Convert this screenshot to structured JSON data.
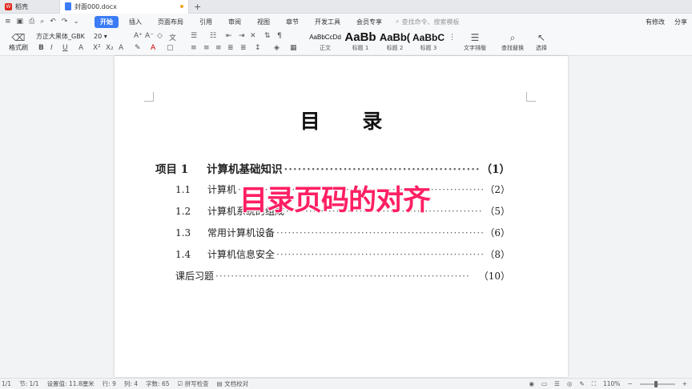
{
  "tabs": [
    {
      "label": "稻壳"
    },
    {
      "label": "封面000.docx"
    }
  ],
  "menu": {
    "tabs": [
      "开始",
      "插入",
      "页面布局",
      "引用",
      "审阅",
      "视图",
      "章节",
      "开发工具",
      "会员专享"
    ],
    "active": "开始",
    "search_placeholder": "查找命令、搜索模板",
    "right": [
      "有修改",
      "分享"
    ]
  },
  "ribbon": {
    "format_brush": "格式刷",
    "font_name": "方正大黑体_GBK",
    "font_size": "20",
    "styles": [
      {
        "preview": "AaBbCcDd",
        "label": "正文"
      },
      {
        "preview": "AaBb",
        "label": "标题 1"
      },
      {
        "preview": "AaBb(",
        "label": "标题 2"
      },
      {
        "preview": "AaBbC",
        "label": "标题 3"
      }
    ],
    "tools": [
      "文字排版",
      "查找替换",
      "选择"
    ]
  },
  "document": {
    "title": "目 录",
    "toc": [
      {
        "num": "项目 1",
        "text": "计算机基础知识",
        "page": "（1）",
        "level": 1
      },
      {
        "num": "1.1",
        "text": "计算机",
        "page": "（2）",
        "level": 2
      },
      {
        "num": "1.2",
        "text": "计算机系统的组成",
        "page": "（5）",
        "level": 2
      },
      {
        "num": "1.3",
        "text": "常用计算机设备",
        "page": "（6）",
        "level": 2
      },
      {
        "num": "1.4",
        "text": "计算机信息安全",
        "page": "（8）",
        "level": 2
      },
      {
        "num": "",
        "text": "课后习题",
        "page": "（10）",
        "level": 2
      }
    ],
    "overlay_caption": "目录页码的对齐"
  },
  "status": {
    "page": "1/1",
    "section": "节: 1/1",
    "setting": "设置值: 11.8厘米",
    "row": "行: 9",
    "col": "列: 4",
    "wordcount": "字数: 65",
    "spellcheck": "拼写检查",
    "proof": "文档校对",
    "zoom": "110%"
  },
  "colors": {
    "accent": "#3b7cf6",
    "overlay": "#ff1f63",
    "logo": "#e2231a"
  }
}
